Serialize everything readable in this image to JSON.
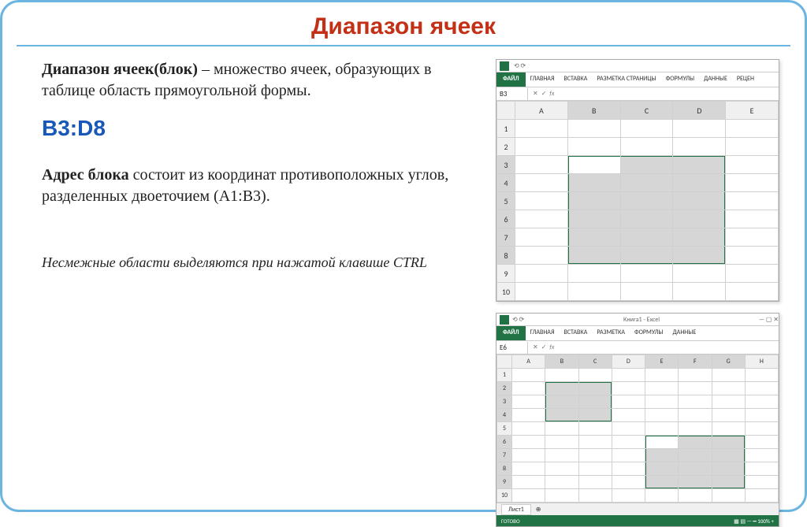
{
  "title": "Диапазон ячеек",
  "def_term": "Диапазон ячеек(блок)",
  "def_text": " – множество ячеек, образующих в таблице область прямоугольной формы.",
  "range_example": "B3:D8",
  "addr_term": "Адрес блока",
  "addr_text": " состоит из координат противоположных углов, разделенных двоеточием (A1:B3).",
  "note": "Несмежные области выделяются при нажатой клавише CTRL",
  "excel": {
    "file_tab": "ФАЙЛ",
    "tabs": [
      "ГЛАВНАЯ",
      "ВСТАВКА",
      "РАЗМЕТКА СТРАНИЦЫ",
      "ФОРМУЛЫ",
      "ДАННЫЕ",
      "РЕЦЕН"
    ],
    "name1": "B3",
    "cols1": [
      "A",
      "B",
      "C",
      "D",
      "E"
    ],
    "rows1": [
      "1",
      "2",
      "3",
      "4",
      "5",
      "6",
      "7",
      "8",
      "9",
      "10"
    ],
    "tabs2": [
      "ГЛАВНАЯ",
      "ВСТАВКА",
      "РАЗМЕТКА",
      "ФОРМУЛЫ",
      "ДАННЫЕ"
    ],
    "title2": "Книга1 - Excel",
    "name2": "E6",
    "cols2": [
      "A",
      "B",
      "C",
      "D",
      "E",
      "F",
      "G",
      "H"
    ],
    "rows2": [
      "1",
      "2",
      "3",
      "4",
      "5",
      "6",
      "7",
      "8",
      "9",
      "10"
    ],
    "sheet": "Лист1",
    "ready": "ГОТОВО"
  }
}
